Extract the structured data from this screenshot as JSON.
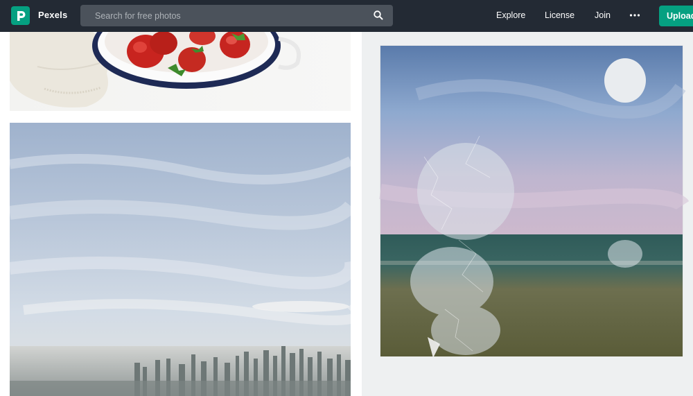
{
  "header": {
    "brand_name": "Pexels",
    "logo_icon": "pexels-logo-icon",
    "search": {
      "placeholder": "Search for free photos",
      "icon": "search-icon"
    },
    "nav": {
      "explore": "Explore",
      "license": "License",
      "join": "Join",
      "more_icon": "more-dots-icon"
    },
    "upload_label": "Upload"
  },
  "colors": {
    "topbar_bg": "#232a34",
    "search_bg": "#4b525b",
    "accent": "#05a081",
    "page_bg": "#ffffff"
  },
  "gallery": {
    "photos": [
      {
        "subject": "strawberries-in-bowl"
      },
      {
        "subject": "city-skyline-under-sky"
      },
      {
        "subject": "polaroid-sea-and-sky"
      }
    ]
  }
}
